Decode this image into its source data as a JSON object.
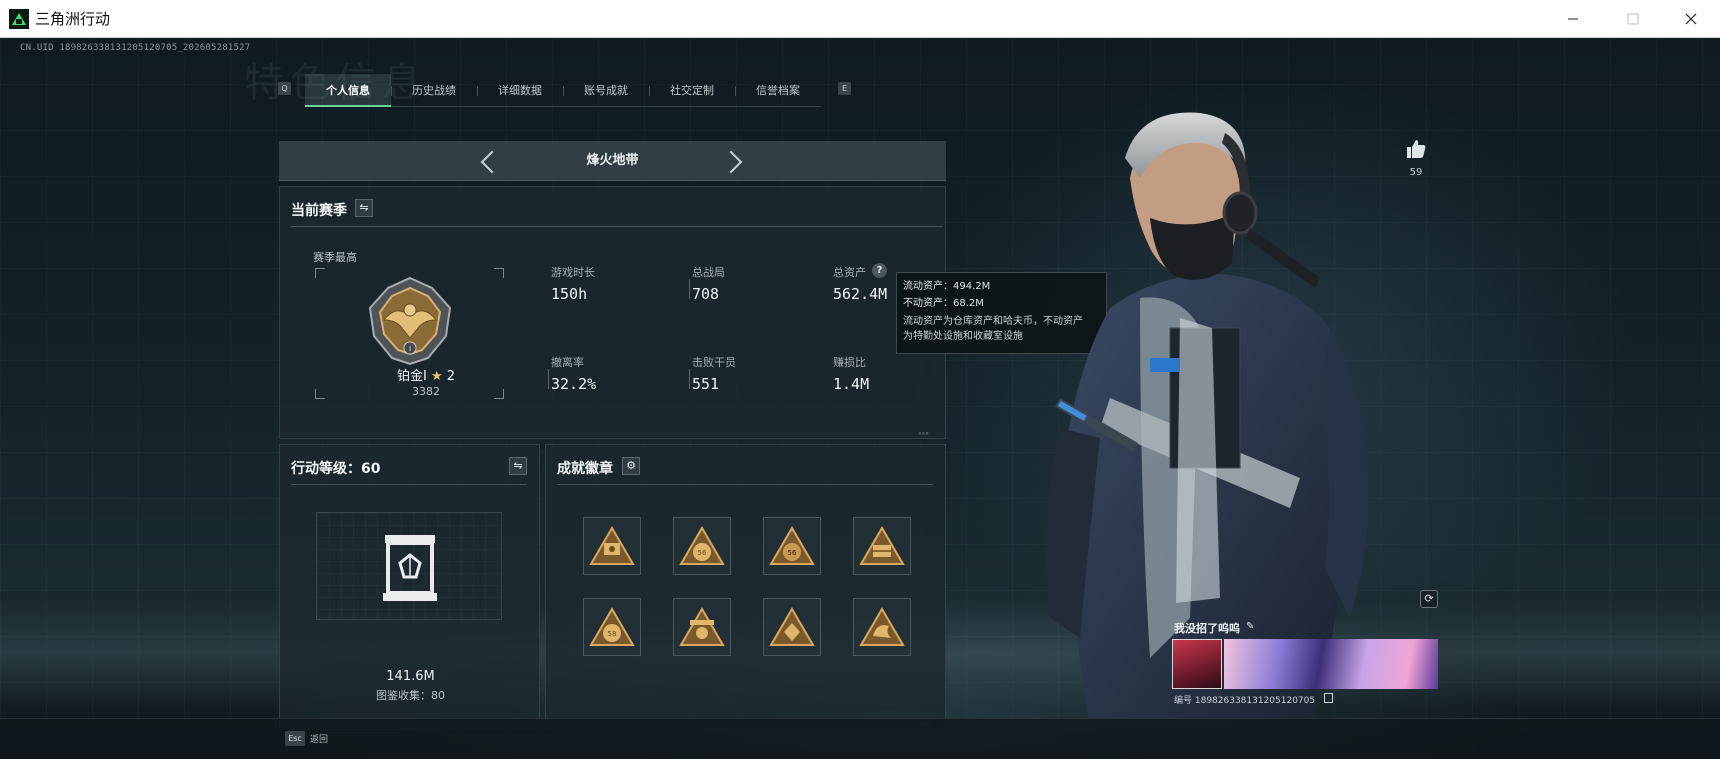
{
  "window": {
    "title": "三角洲行动",
    "min_icon": "minimize-icon",
    "max_icon": "maximize-icon",
    "close_icon": "close-icon"
  },
  "uid_label": "CN.UID 189826338131205120705_202605281527",
  "ghost_title": "特色信息",
  "tabs": {
    "left_key": "Q",
    "right_key": "E",
    "items": [
      {
        "label": "个人信息",
        "active": true
      },
      {
        "label": "历史战绩",
        "active": false
      },
      {
        "label": "详细数据",
        "active": false
      },
      {
        "label": "账号成就",
        "active": false
      },
      {
        "label": "社交定制",
        "active": false
      },
      {
        "label": "信誉档案",
        "active": false
      }
    ]
  },
  "mode_selector": {
    "label": "烽火地带"
  },
  "season": {
    "title": "当前赛季",
    "best_label": "赛季最高",
    "rank_name": "铂金I",
    "rank_star": "★",
    "rank_stars": "2",
    "rank_score": "3382",
    "stats": [
      {
        "label": "游戏时长",
        "value": "150h"
      },
      {
        "label": "总战局",
        "value": "708"
      },
      {
        "label": "总资产",
        "value": "562.4M"
      },
      {
        "label": "撤离率",
        "value": "32.2%"
      },
      {
        "label": "击败干员",
        "value": "551"
      },
      {
        "label": "赚损比",
        "value": "1.4M"
      }
    ],
    "help_glyph": "?"
  },
  "tooltip": {
    "liquid": "流动资产：494.2M",
    "fixed": "不动资产：68.2M",
    "desc_1": "流动资产为仓库资产和哈夫币，不动资产",
    "desc_2": "为特勤处设施和收藏室设施"
  },
  "level": {
    "title": "行动等级：60",
    "collection_value": "141.6M",
    "collection_count": "图鉴收集：80"
  },
  "achievements": {
    "title": "成就徽章",
    "settings_icon": "gear-icon",
    "badges": [
      {
        "name": "badge-1",
        "mark": ""
      },
      {
        "name": "badge-2",
        "mark": "56"
      },
      {
        "name": "badge-3",
        "mark": "56"
      },
      {
        "name": "badge-4",
        "mark": ""
      },
      {
        "name": "badge-5",
        "mark": "58"
      },
      {
        "name": "badge-6",
        "mark": ""
      },
      {
        "name": "badge-7",
        "mark": ""
      },
      {
        "name": "badge-8",
        "mark": ""
      }
    ]
  },
  "profile": {
    "like_count": "59",
    "card_name": "我没招了呜呜",
    "card_id": "编号 189826338131205120705",
    "edit_glyph": "✎",
    "refresh_glyph": "⟳"
  },
  "footer": {
    "esc_key": "Esc",
    "esc_label": "返回"
  },
  "colors": {
    "accent_green": "#69d39a",
    "gold": "#c9a15a",
    "panel_bg": "#1c282e"
  }
}
